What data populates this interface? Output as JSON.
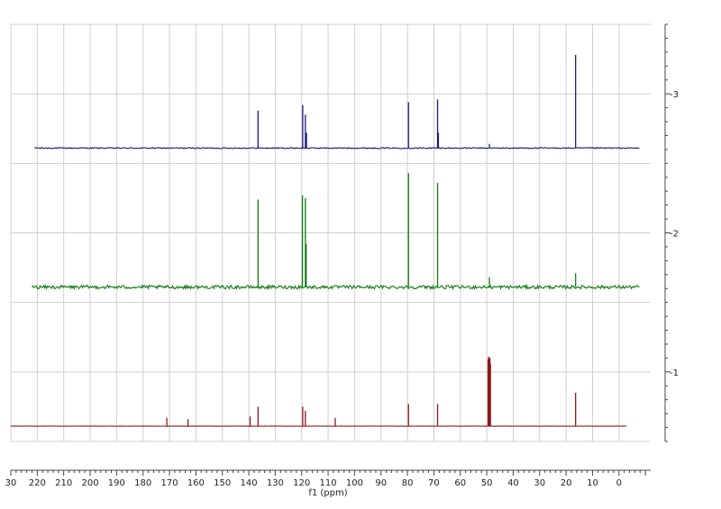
{
  "chart_data": {
    "type": "line",
    "title": "",
    "xlabel": "f1 (ppm)",
    "ylabel": "",
    "x_reversed": true,
    "xlim": [
      230,
      -12
    ],
    "x_ticks": [
      230,
      220,
      210,
      200,
      190,
      180,
      170,
      160,
      150,
      140,
      130,
      120,
      110,
      100,
      90,
      80,
      70,
      60,
      50,
      40,
      30,
      20,
      10,
      0
    ],
    "x_tick_labels": [
      "30",
      "220",
      "210",
      "200",
      "190",
      "180",
      "170",
      "160",
      "150",
      "140",
      "130",
      "120",
      "110",
      "100",
      "90",
      "80",
      "70",
      "60",
      "50",
      "40",
      "30",
      "20",
      "10",
      "0"
    ],
    "ylim": [
      0.5,
      3.5
    ],
    "y_ticks": [
      1,
      2,
      3
    ],
    "y_tick_labels": [
      "1",
      "2",
      "3"
    ],
    "grid": true,
    "series": [
      {
        "color": "#1a1a7a",
        "baseline": 2.61,
        "noise": 0.004,
        "x_range": [
          221,
          -8
        ],
        "peaks": [
          {
            "ppm": 136.5,
            "height": 0.27
          },
          {
            "ppm": 119.6,
            "height": 0.31
          },
          {
            "ppm": 118.6,
            "height": 0.24
          },
          {
            "ppm": 118.2,
            "height": 0.11
          },
          {
            "ppm": 79.6,
            "height": 0.33
          },
          {
            "ppm": 68.6,
            "height": 0.35
          },
          {
            "ppm": 68.3,
            "height": 0.11
          },
          {
            "ppm": 49.0,
            "height": 0.03
          },
          {
            "ppm": 16.4,
            "height": 0.67
          }
        ]
      },
      {
        "color": "#137a13",
        "baseline": 1.61,
        "noise": 0.012,
        "x_range": [
          222,
          -8
        ],
        "peaks": [
          {
            "ppm": 136.5,
            "height": 0.63
          },
          {
            "ppm": 119.7,
            "height": 0.66
          },
          {
            "ppm": 118.6,
            "height": 0.64
          },
          {
            "ppm": 118.3,
            "height": 0.31
          },
          {
            "ppm": 79.6,
            "height": 0.82
          },
          {
            "ppm": 68.6,
            "height": 0.75
          },
          {
            "ppm": 49.0,
            "height": 0.07
          },
          {
            "ppm": 16.4,
            "height": 0.1
          }
        ]
      },
      {
        "color": "#8b1a1a",
        "baseline": 0.61,
        "noise": 0.001,
        "x_range": [
          230,
          -3
        ],
        "peaks": [
          {
            "ppm": 171.0,
            "height": 0.06
          },
          {
            "ppm": 163.0,
            "height": 0.05
          },
          {
            "ppm": 139.5,
            "height": 0.07
          },
          {
            "ppm": 136.5,
            "height": 0.14
          },
          {
            "ppm": 119.6,
            "height": 0.14
          },
          {
            "ppm": 118.6,
            "height": 0.11
          },
          {
            "ppm": 107.3,
            "height": 0.06
          },
          {
            "ppm": 79.6,
            "height": 0.16
          },
          {
            "ppm": 68.6,
            "height": 0.16
          },
          {
            "ppm": 49.5,
            "height": 0.48
          },
          {
            "ppm": 49.3,
            "height": 0.5
          },
          {
            "ppm": 49.0,
            "height": 0.49
          },
          {
            "ppm": 48.8,
            "height": 0.49
          },
          {
            "ppm": 48.6,
            "height": 0.45
          },
          {
            "ppm": 16.4,
            "height": 0.24
          }
        ]
      }
    ]
  }
}
